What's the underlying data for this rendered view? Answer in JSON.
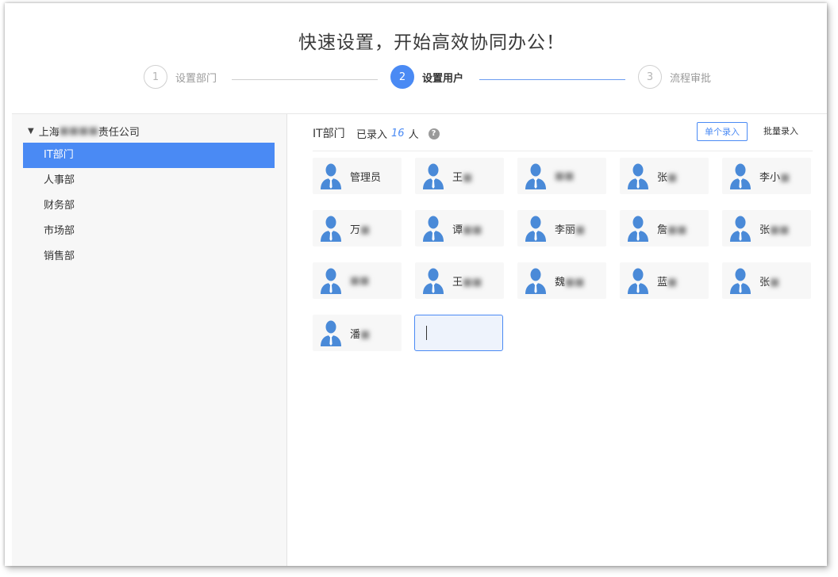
{
  "header": {
    "title": "快速设置，开始高效协同办公！"
  },
  "steps": [
    {
      "number": "1",
      "label": "设置部门",
      "state": "inactive"
    },
    {
      "number": "2",
      "label": "设置用户",
      "state": "active"
    },
    {
      "number": "3",
      "label": "流程审批",
      "state": "inactive"
    }
  ],
  "sidebar": {
    "company": {
      "prefix": "上海",
      "masked": "■■■■",
      "suffix": "责任公司"
    },
    "departments": [
      {
        "label": "IT部门",
        "selected": true
      },
      {
        "label": "人事部",
        "selected": false
      },
      {
        "label": "财务部",
        "selected": false
      },
      {
        "label": "市场部",
        "selected": false
      },
      {
        "label": "销售部",
        "selected": false
      }
    ]
  },
  "main": {
    "dept_name": "IT部门",
    "count_prefix": "已录入",
    "count_value": "16",
    "count_suffix": "人",
    "help_icon": "?",
    "single_entry_label": "单个录入",
    "batch_entry_label": "批量录入",
    "users": [
      {
        "visible": "管理员",
        "masked": ""
      },
      {
        "visible": "王",
        "masked": "■"
      },
      {
        "visible": "",
        "masked": "■■"
      },
      {
        "visible": "张",
        "masked": "■"
      },
      {
        "visible": "李小",
        "masked": "■"
      },
      {
        "visible": "万",
        "masked": "■"
      },
      {
        "visible": "谭",
        "masked": "■■"
      },
      {
        "visible": "李丽",
        "masked": "■"
      },
      {
        "visible": "詹",
        "masked": "■■"
      },
      {
        "visible": "张",
        "masked": "■■"
      },
      {
        "visible": "",
        "masked": "■■"
      },
      {
        "visible": "王",
        "masked": "■■"
      },
      {
        "visible": "魏",
        "masked": "■■"
      },
      {
        "visible": "蓝",
        "masked": "■"
      },
      {
        "visible": "张",
        "masked": "■"
      },
      {
        "visible": "潘",
        "masked": "■"
      }
    ],
    "new_user_value": ""
  },
  "colors": {
    "accent": "#4a8af4",
    "avatar": "#4a8ad8",
    "sidebar_bg": "#f7f7f7",
    "card_bg": "#f7f7f7"
  },
  "icons": {
    "caret": "caret-down-icon",
    "help": "question-circle-icon",
    "avatar": "user-avatar-icon"
  }
}
